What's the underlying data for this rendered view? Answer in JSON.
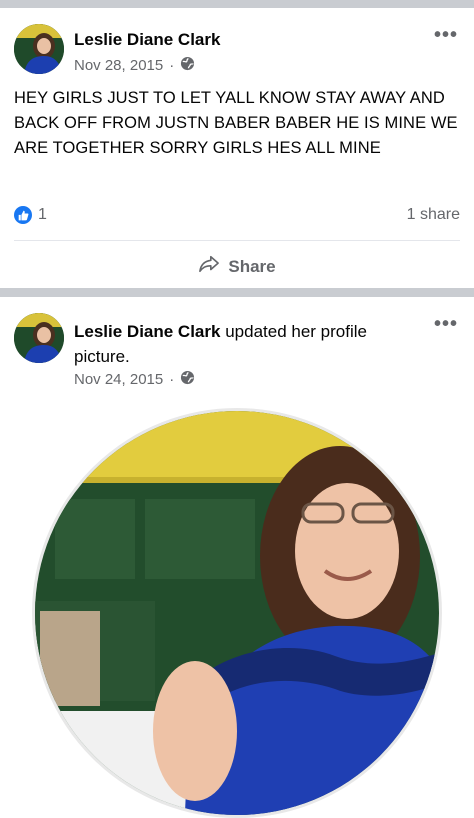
{
  "post1": {
    "author": "Leslie Diane Clark",
    "date": "Nov 28, 2015",
    "text": "HEY GIRLS JUST TO LET YALL KNOW STAY AWAY AND BACK OFF FROM JUSTN BABER BABER HE IS MINE WE ARE TOGETHER SORRY GIRLS HES ALL MINE",
    "reaction_count": "1",
    "share_count": "1 share",
    "share_label": "Share"
  },
  "post2": {
    "author": "Leslie Diane Clark",
    "action": "updated her profile picture.",
    "date": "Nov 24, 2015"
  },
  "icons": {
    "privacy": "globe-icon",
    "more": "more-icon",
    "like": "like-icon",
    "share": "share-icon"
  },
  "colors": {
    "facebook_blue": "#1877f2",
    "divider": "#c9ccd1",
    "secondary_text": "#65676b"
  }
}
